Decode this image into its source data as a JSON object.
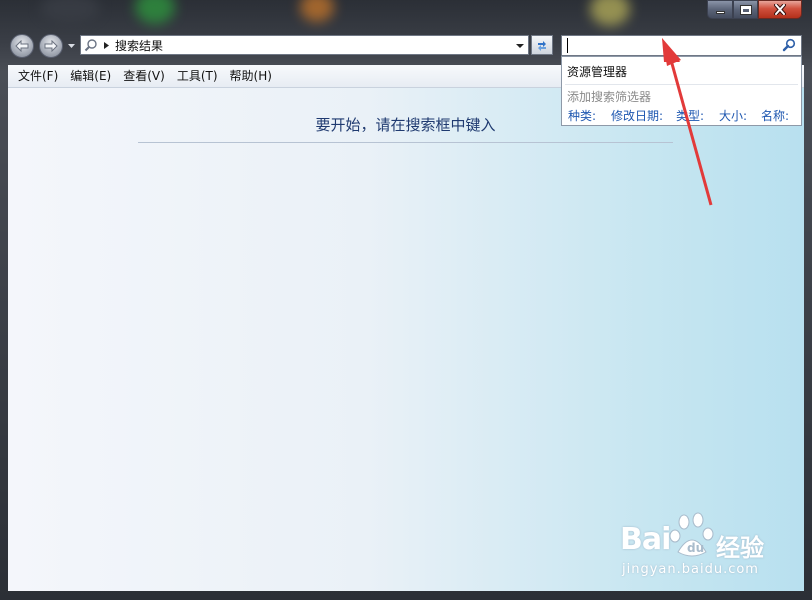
{
  "window": {
    "controls": [
      "minimize",
      "maximize",
      "close"
    ],
    "accent_close": "#c9402b"
  },
  "toolbar": {
    "back_icon": "back-arrow-icon",
    "forward_icon": "forward-arrow-icon",
    "address": {
      "icon": "search-icon",
      "breadcrumb": "搜索结果"
    },
    "refresh_icon": "refresh-icon",
    "search": {
      "value": "",
      "icon": "search-icon"
    }
  },
  "menubar": {
    "items": [
      "文件(F)",
      "编辑(E)",
      "查看(V)",
      "工具(T)",
      "帮助(H)"
    ]
  },
  "content": {
    "prompt": "要开始，请在搜索框中键入"
  },
  "search_dropdown": {
    "history_item": "资源管理器",
    "filter_title": "添加搜索筛选器",
    "filters": [
      "种类:",
      "修改日期:",
      "类型:",
      "大小:",
      "名称:"
    ]
  },
  "annotation": {
    "arrow_color": "#e23a3a"
  },
  "watermark": {
    "logo": "Bai",
    "logo_suffix": "经验",
    "url": "jingyan.baidu.com"
  }
}
